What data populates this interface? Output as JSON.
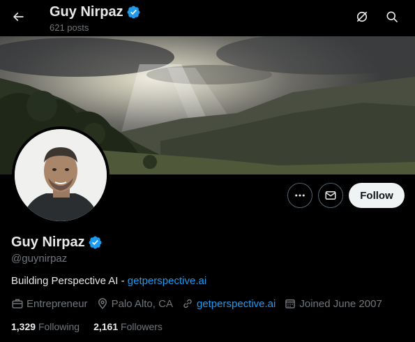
{
  "header": {
    "name": "Guy Nirpaz",
    "posts": "621 posts"
  },
  "profile": {
    "name": "Guy Nirpaz",
    "handle": "@guynirpaz",
    "bio_text": "Building Perspective AI - ",
    "bio_link": "getperspective.ai",
    "follow_label": "Follow"
  },
  "meta": {
    "category": "Entrepreneur",
    "location": "Palo Alto, CA",
    "website": "getperspective.ai",
    "joined": "Joined June 2007"
  },
  "stats": {
    "following_count": "1,329",
    "following_label": "Following",
    "followers_count": "2,161",
    "followers_label": "Followers"
  },
  "colors": {
    "accent": "#1d9bf0",
    "background": "#000000",
    "text": "#e7e9ea",
    "muted": "#71767b"
  },
  "icons": [
    "back-arrow-icon",
    "verified-badge-icon",
    "grok-icon",
    "search-icon",
    "more-icon",
    "message-icon",
    "briefcase-icon",
    "location-icon",
    "link-icon",
    "calendar-icon"
  ]
}
